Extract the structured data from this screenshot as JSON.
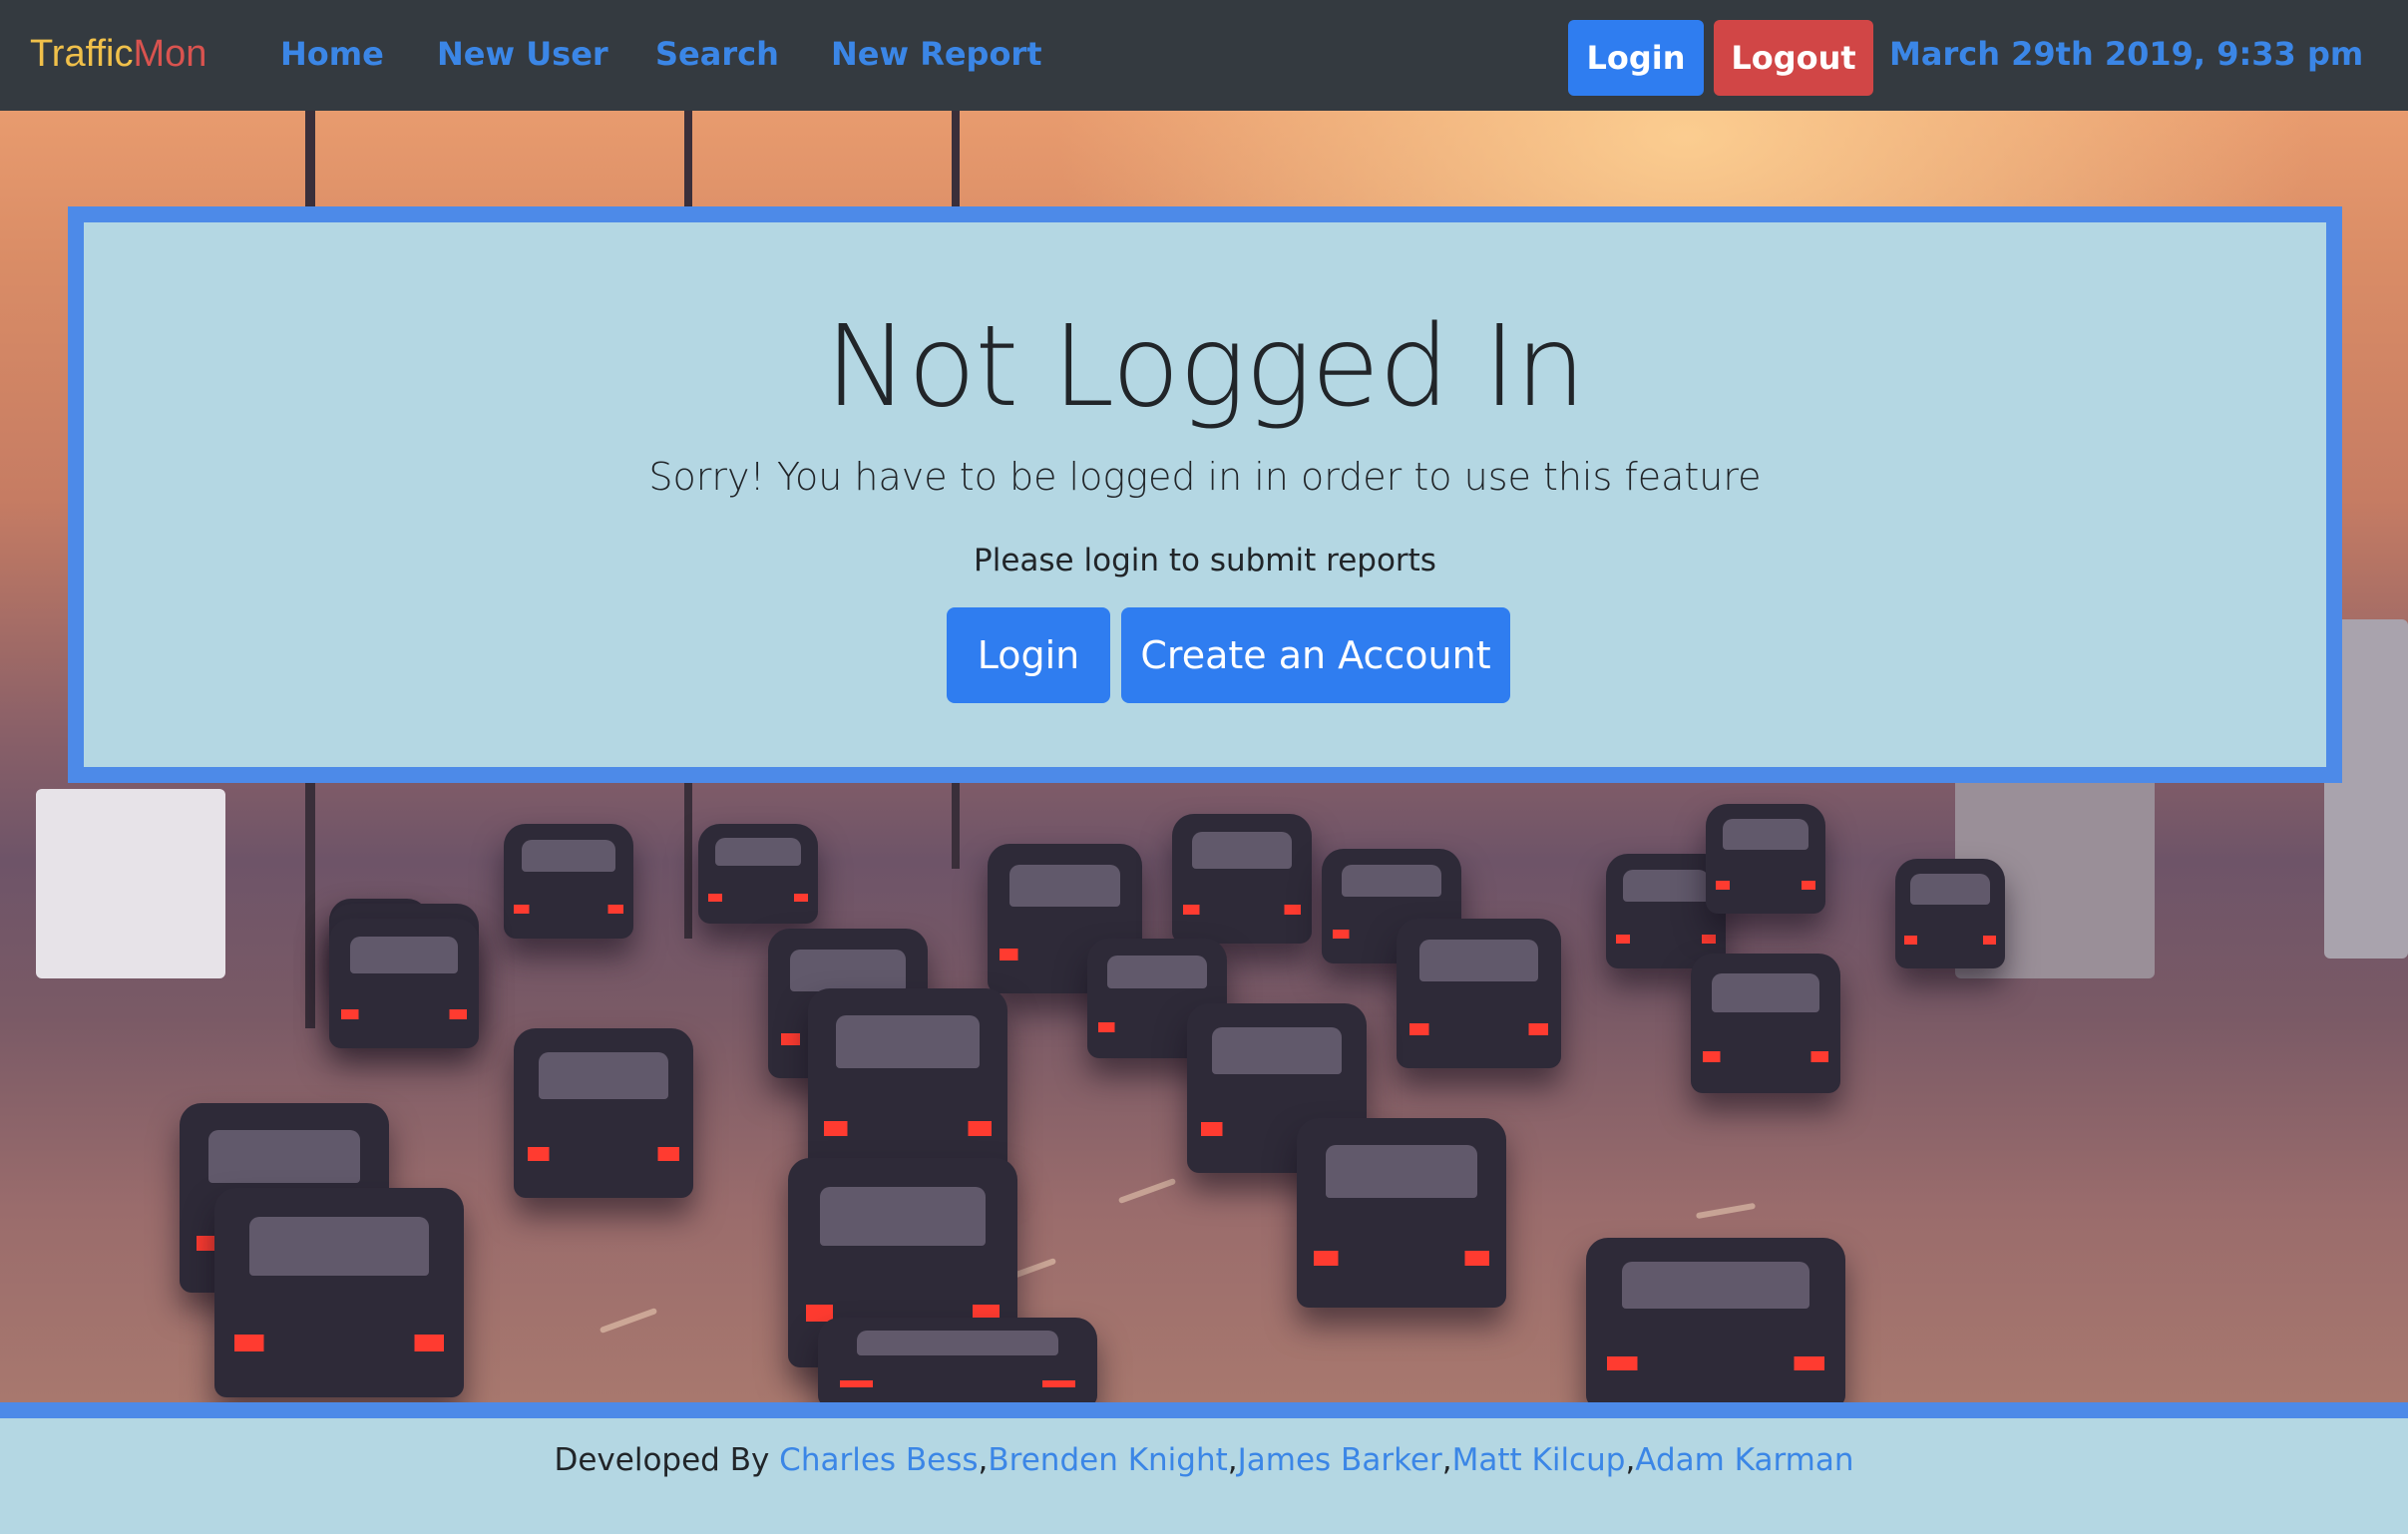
{
  "navbar": {
    "brand_part1": "Traffic",
    "brand_part2": "Mon",
    "links": [
      "Home",
      "New User",
      "Search",
      "New Report"
    ],
    "login_label": "Login",
    "logout_label": "Logout",
    "datetime": "March 29th 2019, 9:33 pm"
  },
  "main": {
    "title": "Not Logged In",
    "lead": "Sorry! You have to be logged in in order to use this feature",
    "message": "Please login to submit reports",
    "login_button": "Login",
    "create_account_button": "Create an Account"
  },
  "footer": {
    "prefix": "Developed By ",
    "developers": [
      "Charles Bess",
      "Brenden Knight",
      "James Barker",
      "Matt Kilcup",
      "Adam Karman"
    ],
    "separator": ","
  },
  "colors": {
    "navbar_bg": "#343a40",
    "link": "#3b86e6",
    "primary": "#2f7df0",
    "danger": "#d14646",
    "panel_bg": "#b4d7e3",
    "panel_border": "#4d8ae8",
    "brand_traffic": "#f0c04a",
    "brand_mon": "#d9534f"
  },
  "hero_image": "sunset-highway-traffic-photo"
}
